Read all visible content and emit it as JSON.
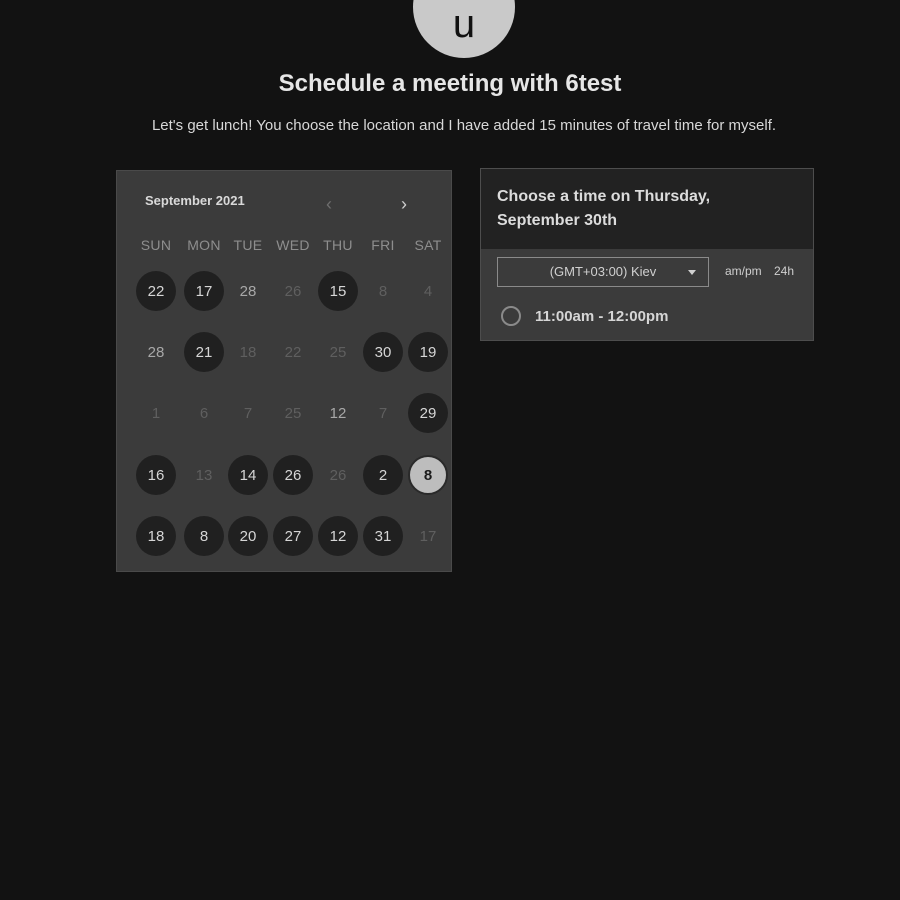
{
  "host": {
    "avatar_initial": "u",
    "title": "Schedule a meeting with 6test",
    "description": "Let's get lunch! You choose the location and I have added 15 minutes of travel time for myself."
  },
  "calendar": {
    "month_label": "September 2021",
    "prev_icon": "chevron-left-icon",
    "next_icon": "chevron-right-icon",
    "weekdays": [
      "SUN",
      "MON",
      "TUE",
      "WED",
      "THU",
      "FRI",
      "SAT"
    ],
    "weeks": [
      [
        {
          "label": "22",
          "state": "available"
        },
        {
          "label": "17",
          "state": "available"
        },
        {
          "label": "28",
          "state": "plain"
        },
        {
          "label": "26",
          "state": "muted"
        },
        {
          "label": "15",
          "state": "available"
        },
        {
          "label": "8",
          "state": "muted"
        },
        {
          "label": "4",
          "state": "muted"
        }
      ],
      [
        {
          "label": "28",
          "state": "plain"
        },
        {
          "label": "21",
          "state": "available"
        },
        {
          "label": "18",
          "state": "muted"
        },
        {
          "label": "22",
          "state": "muted"
        },
        {
          "label": "25",
          "state": "muted"
        },
        {
          "label": "30",
          "state": "available"
        },
        {
          "label": "19",
          "state": "available"
        }
      ],
      [
        {
          "label": "1",
          "state": "muted"
        },
        {
          "label": "6",
          "state": "muted"
        },
        {
          "label": "7",
          "state": "muted"
        },
        {
          "label": "25",
          "state": "muted"
        },
        {
          "label": "12",
          "state": "plain"
        },
        {
          "label": "7",
          "state": "muted"
        },
        {
          "label": "29",
          "state": "available"
        }
      ],
      [
        {
          "label": "16",
          "state": "available"
        },
        {
          "label": "13",
          "state": "muted"
        },
        {
          "label": "14",
          "state": "available"
        },
        {
          "label": "26",
          "state": "available"
        },
        {
          "label": "26",
          "state": "muted"
        },
        {
          "label": "2",
          "state": "available"
        },
        {
          "label": "8",
          "state": "selected"
        }
      ],
      [
        {
          "label": "18",
          "state": "available"
        },
        {
          "label": "8",
          "state": "available"
        },
        {
          "label": "20",
          "state": "available"
        },
        {
          "label": "27",
          "state": "available"
        },
        {
          "label": "12",
          "state": "available"
        },
        {
          "label": "31",
          "state": "available"
        },
        {
          "label": "17",
          "state": "muted"
        }
      ]
    ]
  },
  "times": {
    "heading": "Choose a time on Thursday, September 30th",
    "timezone": "(GMT+03:00) Kiev",
    "format_12h": "am/pm",
    "format_24h": "24h",
    "slots": [
      "11:00am - 12:00pm"
    ]
  }
}
